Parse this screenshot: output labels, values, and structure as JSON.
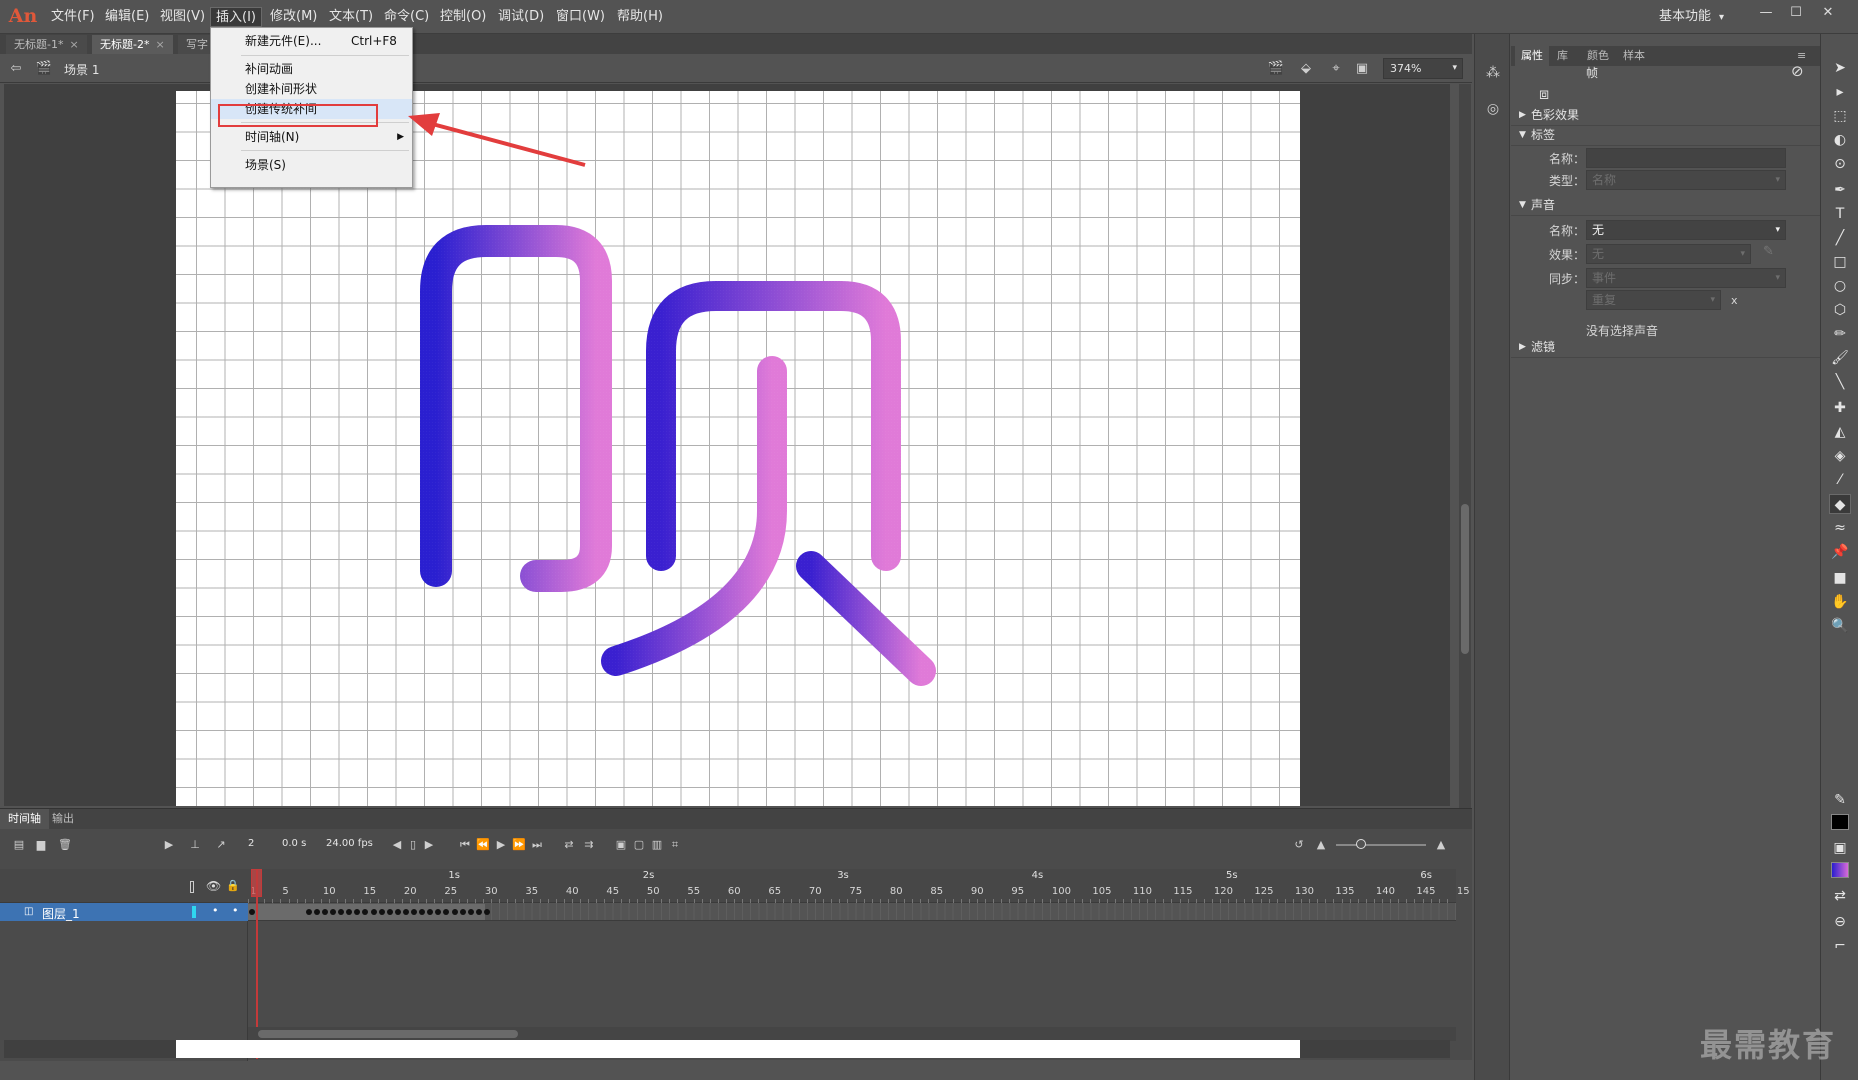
{
  "app": {
    "logo": "An"
  },
  "menubar": {
    "items": [
      {
        "label": "文件(F)"
      },
      {
        "label": "编辑(E)"
      },
      {
        "label": "视图(V)"
      },
      {
        "label": "插入(I)"
      },
      {
        "label": "修改(M)"
      },
      {
        "label": "文本(T)"
      },
      {
        "label": "命令(C)"
      },
      {
        "label": "控制(O)"
      },
      {
        "label": "调试(D)"
      },
      {
        "label": "窗口(W)"
      },
      {
        "label": "帮助(H)"
      }
    ],
    "workspace": "基本功能"
  },
  "doc_tabs": [
    {
      "label": "无标题-1*"
    },
    {
      "label": "无标题-2*"
    },
    {
      "label": "写字"
    }
  ],
  "editbar": {
    "scene": "场景 1",
    "zoom": "374%"
  },
  "insert_menu": {
    "items": [
      {
        "label": "新建元件(E)...",
        "shortcut": "Ctrl+F8"
      },
      {
        "label": "补间动画"
      },
      {
        "label": "创建补间形状"
      },
      {
        "label": "创建传统补间"
      },
      {
        "label": "时间轴(N)"
      },
      {
        "label": "场景(S)"
      }
    ]
  },
  "stage": {
    "glyph_gradient": [
      "#2a1fd0",
      "#e07ad8"
    ]
  },
  "timeline": {
    "tabs": [
      {
        "label": "时间轴"
      },
      {
        "label": "输出"
      }
    ],
    "current_frame": "2",
    "time": "0.0 s",
    "fps": "24.00 fps",
    "seconds": [
      "1s",
      "2s",
      "3s",
      "4s",
      "5s",
      "6s"
    ],
    "frame_numbers": [
      "1",
      "5",
      "10",
      "15",
      "20",
      "25",
      "30",
      "35",
      "40",
      "45",
      "50",
      "55",
      "60",
      "65",
      "70",
      "75",
      "80",
      "85",
      "90",
      "95",
      "100",
      "105",
      "110",
      "115",
      "120",
      "125",
      "130",
      "135",
      "140",
      "145",
      "15"
    ],
    "layer": {
      "name": "图层_1"
    }
  },
  "properties": {
    "tabs": [
      {
        "label": "属性"
      },
      {
        "label": "库"
      },
      {
        "label": "颜色"
      },
      {
        "label": "样本"
      }
    ],
    "object_type": "帧",
    "sections": {
      "color_effect": "色彩效果",
      "label": "标签",
      "sound": "声音",
      "filter": "滤镜"
    },
    "label_name_label": "名称：",
    "label_type_label": "类型：",
    "label_type_value": "名称",
    "sound_name_label": "名称：",
    "sound_name_value": "无",
    "sound_effect_label": "效果：",
    "sound_effect_value": "无",
    "sound_sync_label": "同步：",
    "sound_sync_value": "事件",
    "sound_repeat_value": "重复",
    "sound_repeat_x": "x",
    "no_sound": "没有选择声音"
  },
  "watermark": "最需教育",
  "colors": {
    "accent_highlight": "#e23d3d",
    "layer_selected": "#3d73b3"
  }
}
